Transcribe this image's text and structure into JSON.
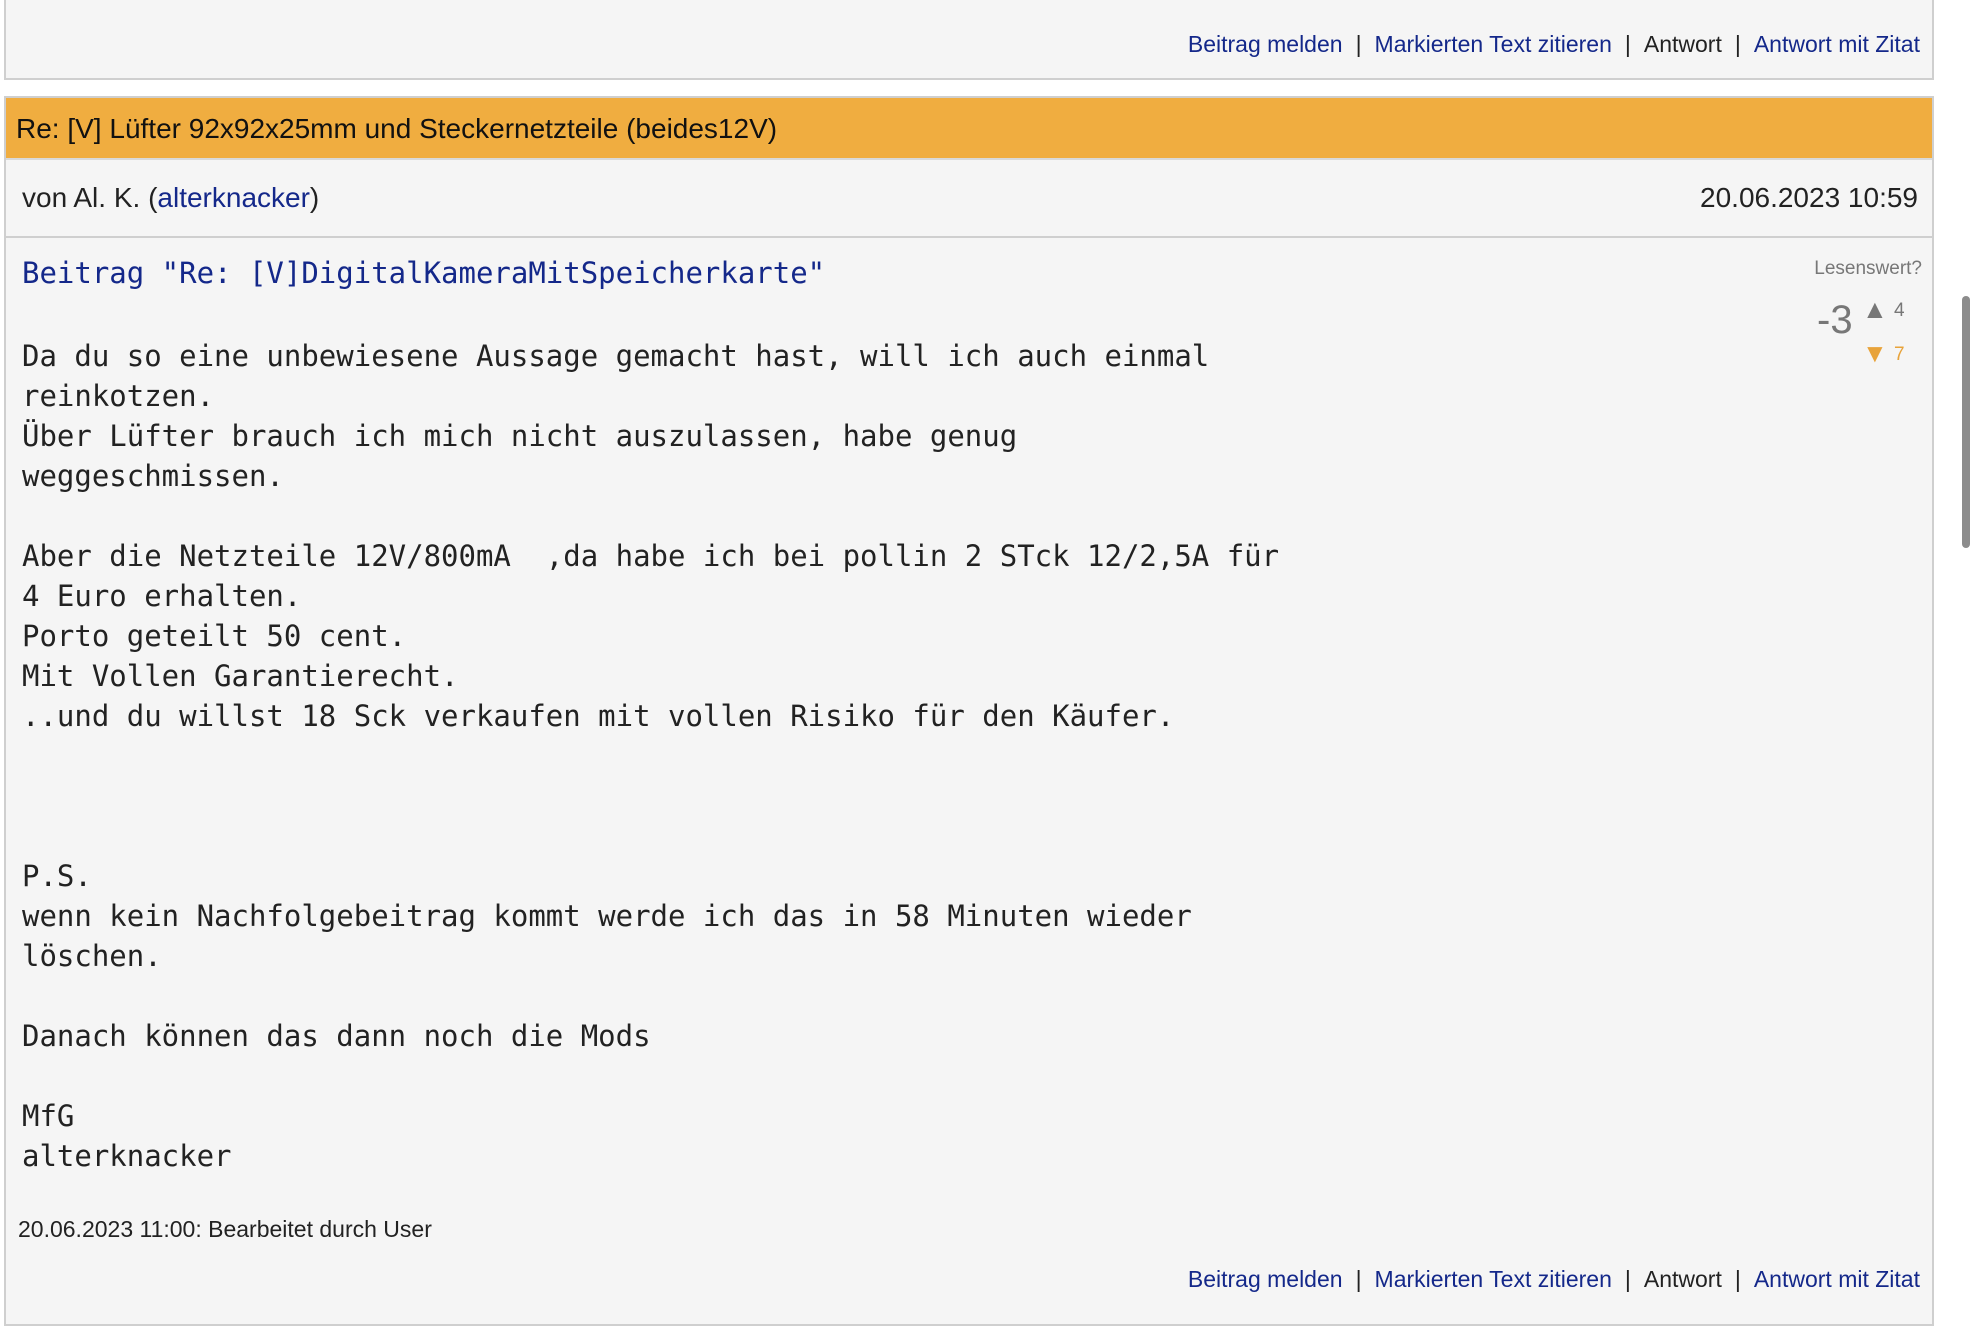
{
  "top_actions": {
    "report": "Beitrag melden",
    "quote_selected": "Markierten Text zitieren",
    "reply": "Antwort",
    "reply_quote": "Antwort mit Zitat",
    "separator": "|"
  },
  "post": {
    "title": "Re: [V] Lüfter 92x92x25mm und Steckernetzteile (beides12V)",
    "author_prefix": "von Al. K. (",
    "author_username": "alterknacker",
    "author_suffix": ")",
    "date": "20.06.2023 10:59",
    "quote_link": "Beitrag \"Re: [V]DigitalKameraMitSpeicherkarte\"",
    "rating": {
      "label": "Lesenswert?",
      "score": "-3",
      "up_icon": "▲",
      "up_count": "4",
      "down_icon": "▼",
      "down_count": "7"
    },
    "body": "Da du so eine unbewiesene Aussage gemacht hast, will ich auch einmal\nreinkotzen.\nÜber Lüfter brauch ich mich nicht auszulassen, habe genug\nweggeschmissen.\n\nAber die Netzteile 12V/800mA  ,da habe ich bei pollin 2 STck 12/2,5A für\n4 Euro erhalten.\nPorto geteilt 50 cent.\nMit Vollen Garantierecht.\n..und du willst 18 Sck verkaufen mit vollen Risiko für den Käufer.\n\n\n\nP.S.\nwenn kein Nachfolgebeitrag kommt werde ich das in 58 Minuten wieder\nlöschen.\n\nDanach können das dann noch die Mods\n\nMfG\nalterknacker",
    "edit_note": "20.06.2023 11:00: Bearbeitet durch User",
    "actions": {
      "report": "Beitrag melden",
      "quote_selected": "Markierten Text zitieren",
      "reply": "Antwort",
      "reply_quote": "Antwort mit Zitat",
      "separator": "|"
    }
  }
}
